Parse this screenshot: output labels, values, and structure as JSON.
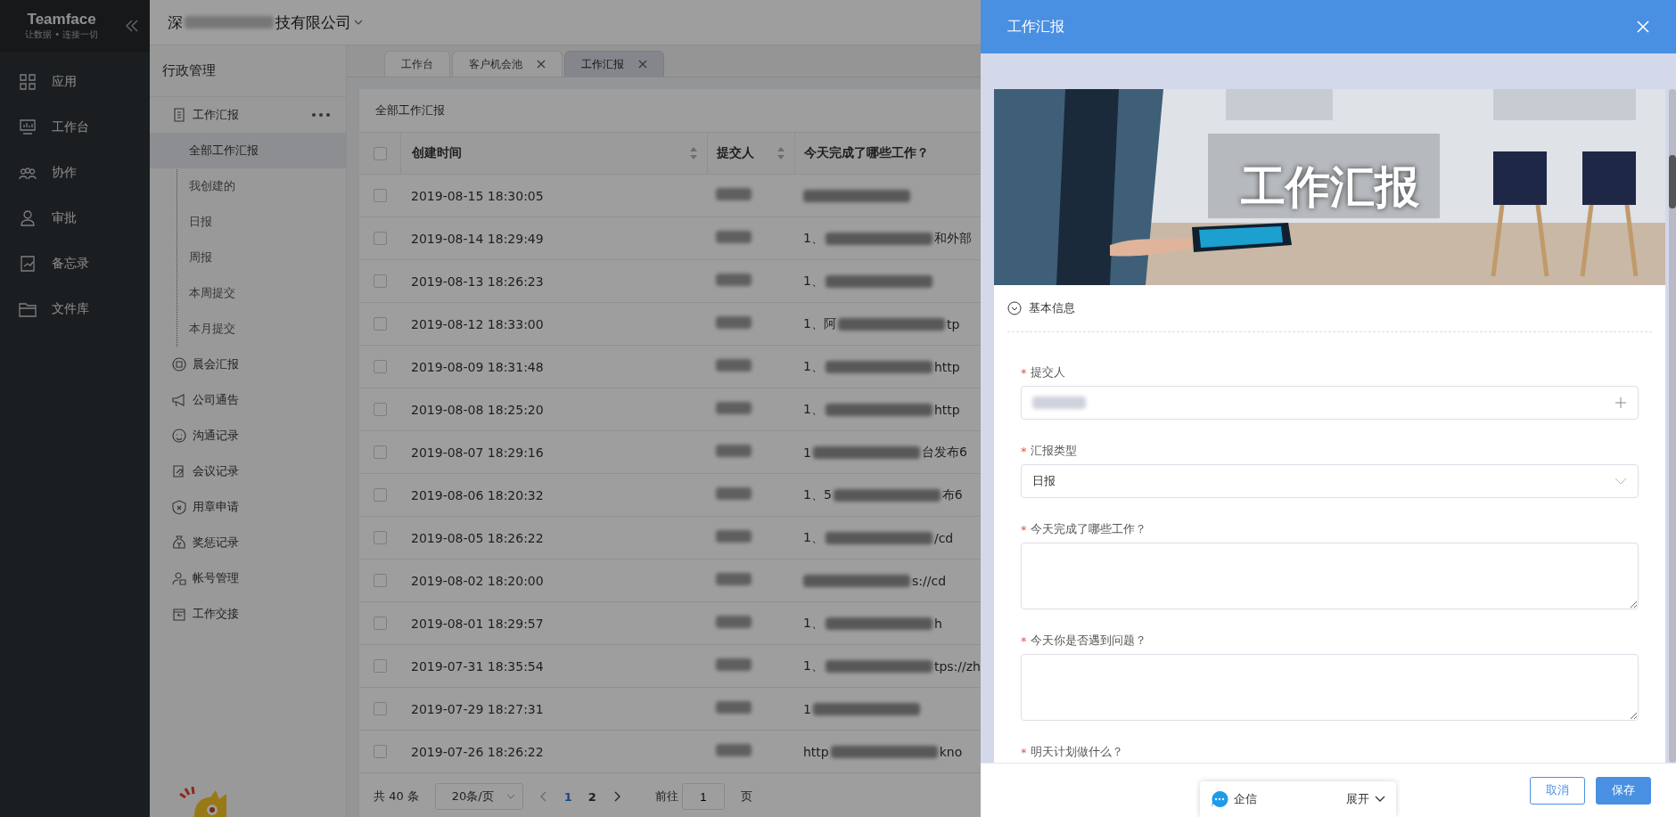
{
  "app": {
    "brand": "Teamface",
    "tagline": "让数据 • 连接一切"
  },
  "nav": [
    {
      "label": "应用"
    },
    {
      "label": "工作台"
    },
    {
      "label": "协作"
    },
    {
      "label": "审批"
    },
    {
      "label": "备忘录"
    },
    {
      "label": "文件库"
    }
  ],
  "header": {
    "company_start": "深",
    "company_end": "技有限公司"
  },
  "subnav": {
    "title": "行政管理",
    "items": [
      {
        "label": "工作汇报",
        "expanded": true,
        "children": [
          {
            "label": "全部工作汇报",
            "selected": true
          },
          {
            "label": "我创建的",
            "selected": false
          },
          {
            "label": "日报",
            "selected": false
          },
          {
            "label": "周报",
            "selected": false
          },
          {
            "label": "本周提交",
            "selected": false
          },
          {
            "label": "本月提交",
            "selected": false
          }
        ]
      },
      {
        "label": "晨会汇报"
      },
      {
        "label": "公司通告"
      },
      {
        "label": "沟通记录"
      },
      {
        "label": "会议记录"
      },
      {
        "label": "用章申请"
      },
      {
        "label": "奖惩记录"
      },
      {
        "label": "帐号管理"
      },
      {
        "label": "工作交接"
      }
    ]
  },
  "tabs": [
    {
      "label": "工作台",
      "closable": false,
      "selected": false
    },
    {
      "label": "客户机会池",
      "closable": true,
      "selected": false
    },
    {
      "label": "工作汇报",
      "closable": true,
      "selected": true
    }
  ],
  "table": {
    "title": "全部工作汇报",
    "select_all_checked": false,
    "columns": [
      {
        "label": "创建时间",
        "sortable": true
      },
      {
        "label": "提交人",
        "sortable": true
      },
      {
        "label": "今天完成了哪些工作？"
      }
    ],
    "rows": [
      {
        "created": "2019-08-15 18:30:05",
        "checked": false
      },
      {
        "created": "2019-08-14 18:29:49",
        "checked": false,
        "content_start": "1、",
        "content_end": "和外部"
      },
      {
        "created": "2019-08-13 18:26:23",
        "checked": false,
        "content_start": "1、"
      },
      {
        "created": "2019-08-12 18:33:00",
        "checked": false,
        "content_start": "1、阿",
        "content_end": "tp"
      },
      {
        "created": "2019-08-09 18:31:48",
        "checked": false,
        "content_start": "1、",
        "content_end": "http"
      },
      {
        "created": "2019-08-08 18:25:20",
        "checked": false,
        "content_start": "1、",
        "content_end": "http"
      },
      {
        "created": "2019-08-07 18:29:16",
        "checked": false,
        "content_start": "1",
        "content_end": "台发布6"
      },
      {
        "created": "2019-08-06 18:20:32",
        "checked": false,
        "content_start": "1、5",
        "content_end": "布6"
      },
      {
        "created": "2019-08-05 18:26:22",
        "checked": false,
        "content_start": "1、",
        "content_end": "/cd"
      },
      {
        "created": "2019-08-02 18:20:00",
        "checked": false,
        "content_end": "s://cd"
      },
      {
        "created": "2019-08-01 18:29:57",
        "checked": false,
        "content_start": "1、",
        "content_end": "h"
      },
      {
        "created": "2019-07-31 18:35:54",
        "checked": false,
        "content_start": "1、",
        "content_end": "tps://zh"
      },
      {
        "created": "2019-07-29 18:27:31",
        "checked": false,
        "content_start": "1"
      },
      {
        "created": "2019-07-26 18:26:22",
        "checked": false,
        "content_start": "http",
        "content_end": "kno"
      }
    ]
  },
  "pagination": {
    "total": "共 40 条",
    "page_size": "20条/页",
    "pages": [
      {
        "label": "1",
        "selected": true
      },
      {
        "label": "2",
        "selected": false
      }
    ],
    "goto_label": "前往",
    "goto_value": "1",
    "page_unit": "页"
  },
  "drawer": {
    "title": "工作汇报",
    "banner_title": "工作汇报",
    "section": {
      "label": "基本信息",
      "expanded": true
    },
    "fields": [
      {
        "label": "提交人",
        "kind": "person",
        "required_mark": "*"
      },
      {
        "label": "汇报类型",
        "kind": "select",
        "required_mark": "*",
        "value": "日报"
      },
      {
        "label": "今天完成了哪些工作？",
        "kind": "textarea",
        "required_mark": "*"
      },
      {
        "label": "今天你是否遇到问题？",
        "kind": "textarea",
        "required_mark": "*"
      },
      {
        "label": "明天计划做什么？",
        "kind": "textarea",
        "required_mark": "*"
      }
    ],
    "buttons": [
      {
        "label": "取消",
        "kind": "secondary"
      },
      {
        "label": "保存",
        "kind": "primary"
      }
    ]
  },
  "chat": {
    "label": "企信",
    "toggle": "展开"
  }
}
